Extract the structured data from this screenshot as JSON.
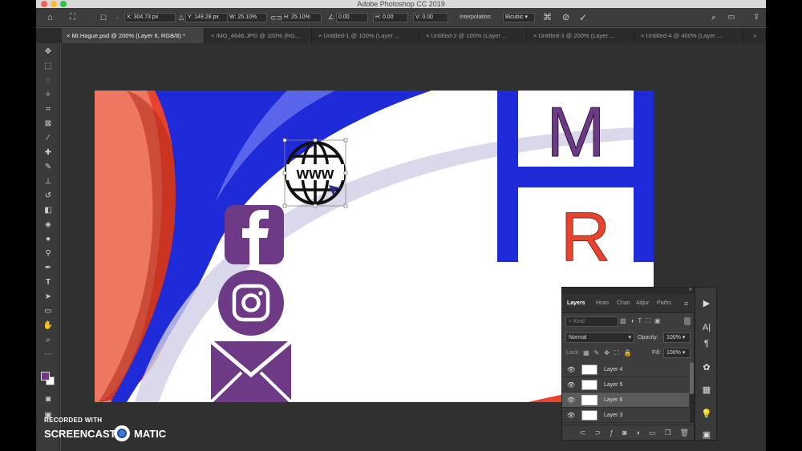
{
  "app": {
    "title": "Adobe Photoshop CC 2019"
  },
  "options": {
    "x_label": "X:",
    "x_value": "304.73 px",
    "y_label": "Y:",
    "y_value": "149.28 px",
    "w_label": "W:",
    "w_value": "25.10%",
    "h_label": "H:",
    "h_value": "25.10%",
    "angle_value": "0.00",
    "hskew_label": "H:",
    "hskew_value": "0.00",
    "vskew_label": "V:",
    "vskew_value": "0.00",
    "interp_label": "Interpolation:",
    "interp_value": "Bicubic"
  },
  "tabs": [
    "Mr.Hague.psd @ 200% (Layer 6, RGB/8) *",
    "IMG_4646.JPG @ 100% (RG...",
    "Untitled-1 @ 100% (Layer ...",
    "Untitled-2 @ 100% (Layer ...",
    "Untitled-3 @ 200% (Layer ...",
    "Untitled-4 @ 400% (Layer ..."
  ],
  "canvas": {
    "www_text": "www",
    "logo_m": "M",
    "logo_r": "R"
  },
  "layers": {
    "tabs": [
      "Layers",
      "Histo",
      "Chan",
      "Adjur",
      "Paths"
    ],
    "search_placeholder": "Kind",
    "blend_mode": "Normal",
    "opacity_label": "Opacity:",
    "opacity_value": "100%",
    "lock_label": "Lock:",
    "fill_label": "Fill:",
    "fill_value": "100%",
    "items": [
      "Layer 4",
      "Layer 5",
      "Layer 6",
      "Layer 3"
    ],
    "selected_index": 2
  },
  "watermark": {
    "line1": "RECORDED WITH",
    "line2a": "SCREENCAST",
    "line2b": "MATIC"
  },
  "colors": {
    "blue": "#1f2bd8",
    "purple": "#6e3a86",
    "red": "#e8432e",
    "salmon": "#ee7762"
  }
}
